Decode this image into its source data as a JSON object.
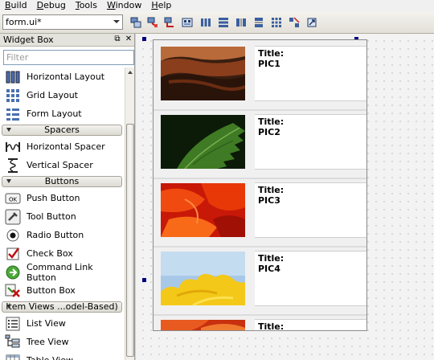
{
  "menu": [
    {
      "accel": "B",
      "rest": "uild"
    },
    {
      "accel": "D",
      "rest": "ebug"
    },
    {
      "accel": "T",
      "rest": "ools"
    },
    {
      "accel": "W",
      "rest": "indow"
    },
    {
      "accel": "H",
      "rest": "elp"
    }
  ],
  "toolbar": {
    "file_combo_value": "form.ui*",
    "icons": [
      "edit-widgets-icon",
      "edit-signals-slots-icon",
      "edit-buddies-icon",
      "edit-tab-order-icon",
      "layout-horizontal-icon",
      "layout-vertical-icon",
      "layout-horizontal-splitter-icon",
      "layout-vertical-splitter-icon",
      "layout-grid-icon",
      "break-layout-icon",
      "adjust-size-icon"
    ]
  },
  "widget_box": {
    "title": "Widget Box",
    "float_button": "⧉",
    "close_button": "✕",
    "filter_placeholder": "Filter",
    "items": [
      {
        "type": "item",
        "label": "Horizontal Layout",
        "icon": "horizontal-layout-icon"
      },
      {
        "type": "item",
        "label": "Grid Layout",
        "icon": "grid-layout-icon"
      },
      {
        "type": "item",
        "label": "Form Layout",
        "icon": "form-layout-icon"
      },
      {
        "type": "category",
        "label": "Spacers"
      },
      {
        "type": "item",
        "label": "Horizontal Spacer",
        "icon": "horizontal-spacer-icon"
      },
      {
        "type": "item",
        "label": "Vertical Spacer",
        "icon": "vertical-spacer-icon"
      },
      {
        "type": "category",
        "label": "Buttons"
      },
      {
        "type": "item",
        "label": "Push Button",
        "icon": "push-button-icon"
      },
      {
        "type": "item",
        "label": "Tool Button",
        "icon": "tool-button-icon"
      },
      {
        "type": "item",
        "label": "Radio Button",
        "icon": "radio-button-icon"
      },
      {
        "type": "item",
        "label": "Check Box",
        "icon": "check-box-icon"
      },
      {
        "type": "item",
        "label": "Command Link Button",
        "icon": "command-link-button-icon"
      },
      {
        "type": "item",
        "label": "Button Box",
        "icon": "button-box-icon"
      },
      {
        "type": "category",
        "label": "Item Views ...odel-Based)"
      },
      {
        "type": "item",
        "label": "List View",
        "icon": "list-view-icon"
      },
      {
        "type": "item",
        "label": "Tree View",
        "icon": "tree-view-icon"
      },
      {
        "type": "item",
        "label": "Table View",
        "icon": "table-view-icon"
      }
    ]
  },
  "form": {
    "rows": [
      {
        "title": "Title:",
        "name": "PIC1",
        "image": "canyon-photo"
      },
      {
        "title": "Title:",
        "name": "PIC2",
        "image": "green-leaf-photo"
      },
      {
        "title": "Title:",
        "name": "PIC3",
        "image": "red-petals-photo"
      },
      {
        "title": "Title:",
        "name": "PIC4",
        "image": "yellow-flower-sky-photo"
      },
      {
        "title": "Title:",
        "name": "",
        "image": "red-orange-photo"
      }
    ]
  },
  "colors": {
    "menu_bg": "#f0f0f0",
    "selection_handle": "#000080",
    "canvas_bg": "#f3f3f3"
  }
}
